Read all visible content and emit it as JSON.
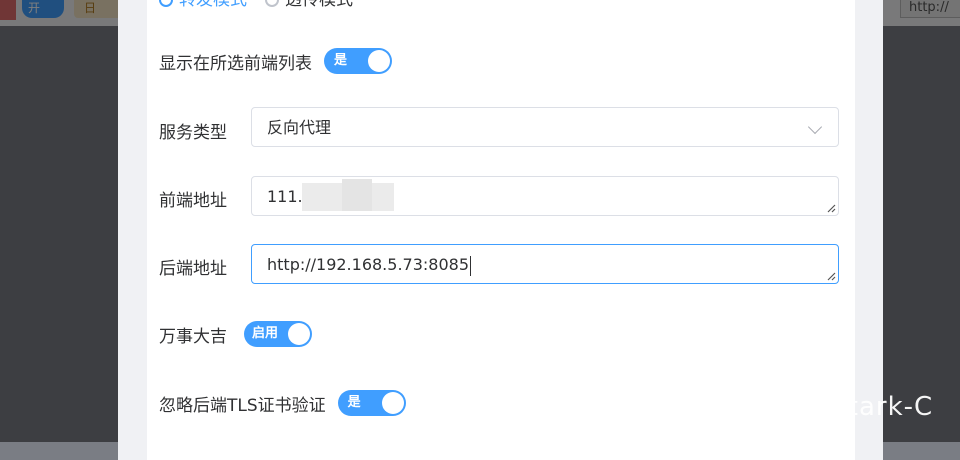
{
  "background": {
    "toggle_text": "开",
    "chip_text": "日",
    "url_text": "http://"
  },
  "dialog": {
    "top_options": [
      "转发模式",
      "透传模式"
    ],
    "show_in_list": {
      "label": "显示在所选前端列表",
      "switch_text": "是"
    },
    "service_type": {
      "label": "服务类型",
      "value": "反向代理"
    },
    "frontend": {
      "label": "前端地址",
      "value": "111."
    },
    "backend": {
      "label": "后端地址",
      "value": "http://192.168.5.73:8085"
    },
    "lucky": {
      "label": "万事大吉",
      "switch_text": "启用"
    },
    "ignore_tls": {
      "label": "忽略后端TLS证书验证",
      "switch_text": "是"
    }
  },
  "watermark": "知乎 @Stark-C",
  "colors": {
    "accent": "#409eff",
    "overlay": "rgba(0,0,0,0.5)"
  }
}
